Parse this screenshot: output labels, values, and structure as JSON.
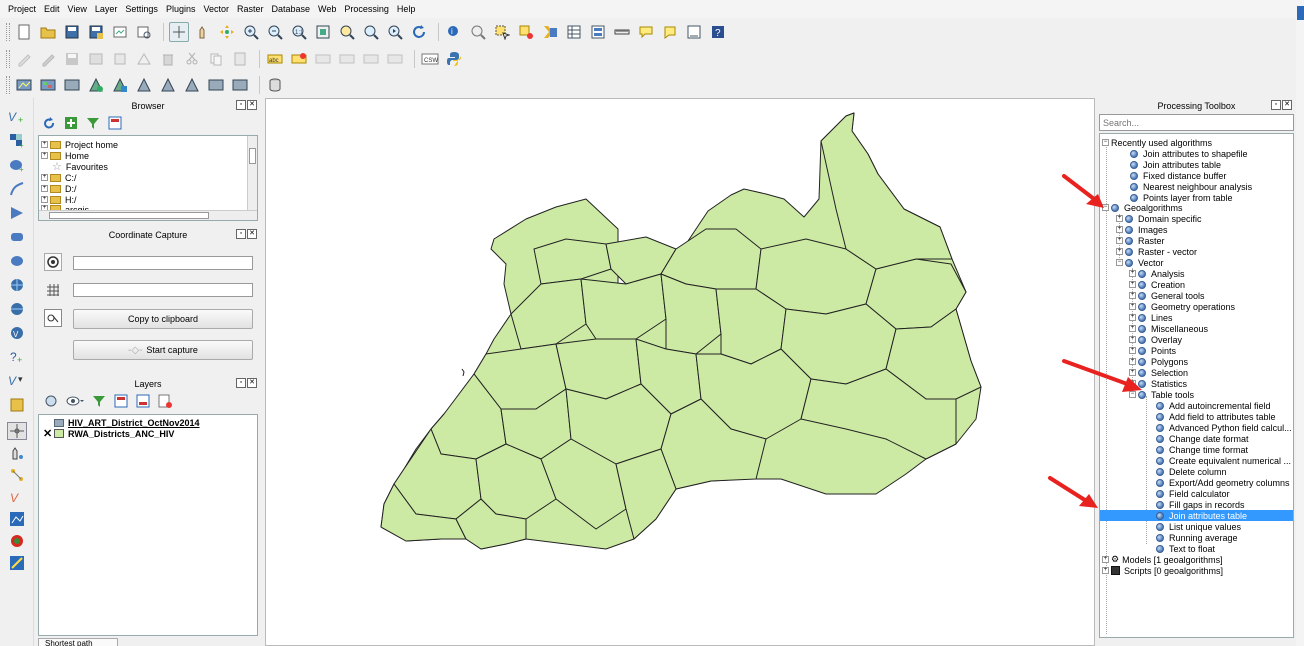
{
  "menu": [
    "Project",
    "Edit",
    "View",
    "Layer",
    "Settings",
    "Plugins",
    "Vector",
    "Raster",
    "Database",
    "Web",
    "Processing",
    "Help"
  ],
  "icons": {
    "toolbar_row1": [
      "new-project-icon",
      "open-project-icon",
      "save-project-icon",
      "save-as-icon",
      "new-print-composer-icon",
      "composer-manager-icon",
      "pan-map-icon",
      "pan-to-selection-icon",
      "zoom-in-icon",
      "zoom-out-icon",
      "zoom-actual-icon",
      "zoom-full-icon",
      "zoom-to-selection-icon",
      "zoom-to-layer-icon",
      "zoom-last-icon",
      "zoom-next-icon",
      "refresh-icon",
      "identify-icon",
      "measure-icon",
      "select-features-icon",
      "deselect-icon",
      "open-attribute-table-icon",
      "field-calculator-icon",
      "map-tips-icon",
      "bookmark-icon",
      "annotation-icon",
      "text-annotation-icon",
      "help-icon",
      "whats-this-icon"
    ],
    "toolbar_row2": [
      "current-edits-icon",
      "toggle-editing-icon",
      "save-edits-icon",
      "add-feature-icon",
      "move-feature-icon",
      "node-tool-icon",
      "delete-selected-icon",
      "cut-features-icon",
      "copy-features-icon",
      "paste-features-icon",
      "label-icon",
      "pin-labels-icon",
      "show-labels-icon",
      "move-label-icon",
      "rotate-label-icon",
      "change-label-icon",
      "csw-icon",
      "python-icon"
    ],
    "toolbar_row3": [
      "add-vector-layer-icon",
      "add-raster-layer-icon",
      "add-postgis-layer-icon",
      "add-spatialite-layer-icon",
      "add-mssql-layer-icon",
      "add-wms-layer-icon",
      "add-wcs-layer-icon",
      "add-wfs-layer-icon",
      "add-delimited-text-icon",
      "new-shapefile-icon",
      "db-manager-icon"
    ]
  },
  "browser": {
    "title": "Browser",
    "items": [
      "Project home",
      "Home",
      "Favourites",
      "C:/",
      "D:/",
      "H:/",
      "arcgis"
    ]
  },
  "coordinate_capture": {
    "title": "Coordinate Capture",
    "copy_button": "Copy to clipboard",
    "start_button": "Start capture"
  },
  "layers": {
    "title": "Layers",
    "items": [
      "HIV_ART_District_OctNov2014",
      "RWA_Districts_ANC_HIV"
    ]
  },
  "processing": {
    "title": "Processing Toolbox",
    "search_placeholder": "Search...",
    "recently_used": "Recently used algorithms",
    "recent_items": [
      "Join attributes to shapefile",
      "Join attributes table",
      "Fixed distance buffer",
      "Nearest neighbour analysis",
      "Points layer from table"
    ],
    "geoalgorithms": "Geoalgorithms",
    "geo_groups": [
      "Domain specific",
      "Images",
      "Raster",
      "Raster - vector",
      "Vector"
    ],
    "vector_groups": [
      "Analysis",
      "Creation",
      "General tools",
      "Geometry operations",
      "Lines",
      "Miscellaneous",
      "Overlay",
      "Points",
      "Polygons",
      "Selection",
      "Statistics",
      "Table tools"
    ],
    "table_tools": [
      "Add autoincremental field",
      "Add field to attributes table",
      "Advanced Python field calcul...",
      "Change date format",
      "Change time format",
      "Create equivalent numerical ...",
      "Delete column",
      "Export/Add geometry columns",
      "Field calculator",
      "Fill gaps in records",
      "Join attributes table",
      "List unique values",
      "Running average",
      "Text to float"
    ],
    "models": "Models [1 geoalgorithms]",
    "scripts": "Scripts [0 geoalgorithms]"
  },
  "bottom_tab": "Shortest path",
  "colors": {
    "map_fill": "#cdeaa5",
    "selection": "#3399ff",
    "annotation_arrow": "#e8231f"
  }
}
